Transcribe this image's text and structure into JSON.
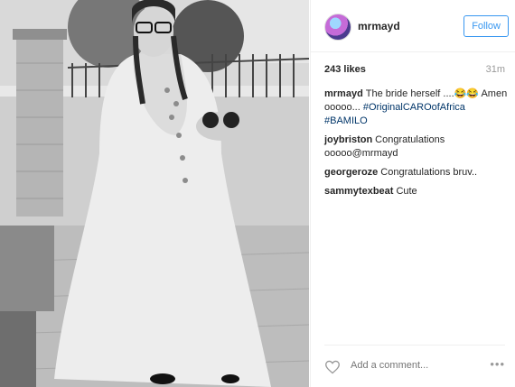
{
  "post": {
    "username": "mrmayd",
    "follow_label": "Follow",
    "likes": "243 likes",
    "time": "31m",
    "caption_author": "mrmayd",
    "caption_text": "The bride herself ....😂😂 Amen ooooo... ",
    "caption_tag1": "#OriginalCAROofAfrica",
    "caption_tag2": "#BAMILO"
  },
  "comments": [
    {
      "author": "joybriston",
      "text": "Congratulations ooooo@mrmayd"
    },
    {
      "author": "georgeroze",
      "text": "Congratulations bruv.."
    },
    {
      "author": "sammytexbeat",
      "text": "Cute"
    }
  ],
  "footer": {
    "comment_placeholder": "Add a comment...",
    "more_label": "•••"
  },
  "icons": {
    "like": "heart-icon",
    "more": "more-options-icon"
  }
}
